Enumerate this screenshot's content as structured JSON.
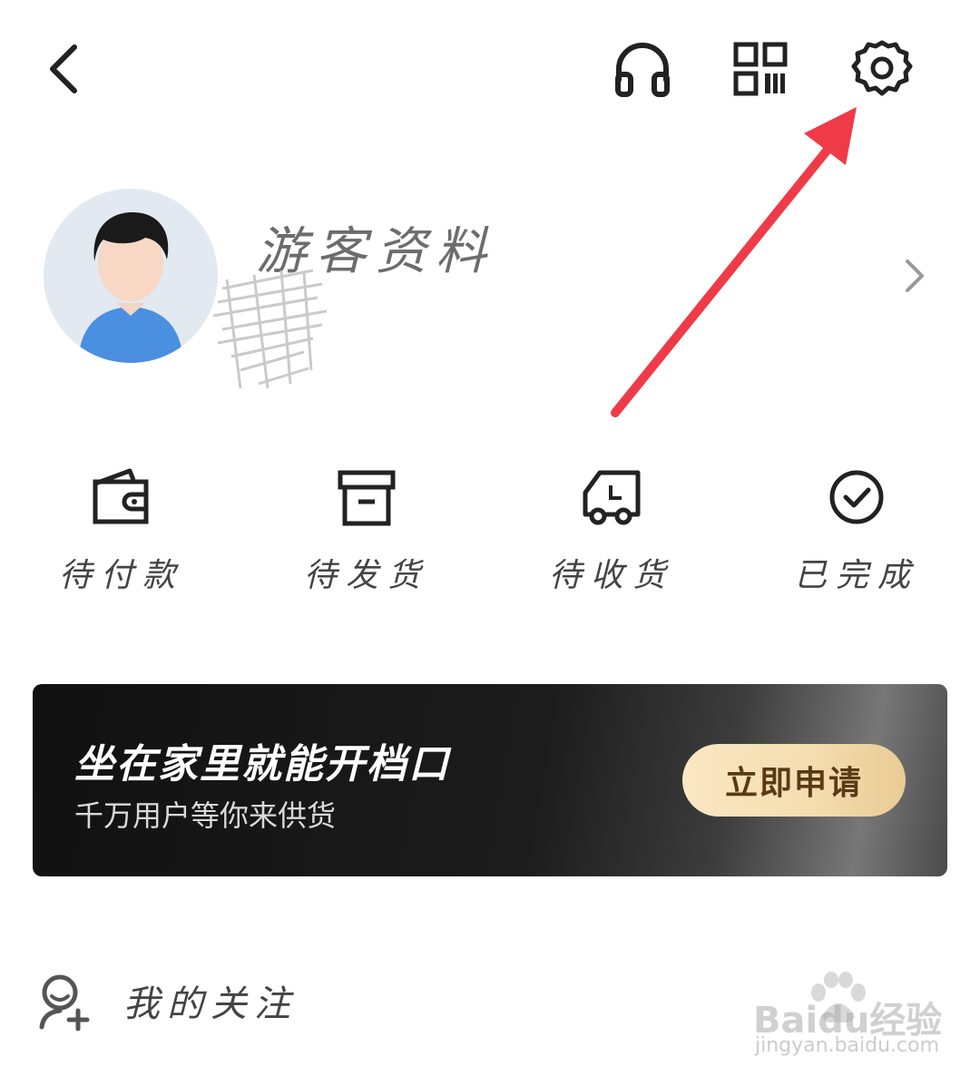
{
  "header": {
    "back_icon": "back-chevron-icon",
    "support_icon": "headphones-icon",
    "qr_icon": "qr-code-icon",
    "settings_icon": "gear-icon"
  },
  "profile": {
    "nickname": "游客资料",
    "avatar": "default-user-avatar",
    "chevron_icon": "chevron-right-icon"
  },
  "orders": [
    {
      "label": "待付款",
      "icon": "wallet-icon"
    },
    {
      "label": "待发货",
      "icon": "box-icon"
    },
    {
      "label": "待收货",
      "icon": "truck-icon"
    },
    {
      "label": "已完成",
      "icon": "check-circle-icon"
    }
  ],
  "banner": {
    "title": "坐在家里就能开档口",
    "subtitle": "千万用户等你来供货",
    "button_label": "立即申请"
  },
  "menu": {
    "follow_label": "我的关注",
    "follow_icon": "user-add-icon"
  },
  "watermark": {
    "brand": "Baidu经验",
    "url": "jingyan.baidu.com"
  },
  "colors": {
    "annotation_arrow": "#ef3b47",
    "banner_bg": "#151515",
    "button_gold": "#f4dcae",
    "button_text": "#5a3a14",
    "avatar_bg": "#e3e9f1",
    "avatar_shirt": "#4a8fe0"
  }
}
